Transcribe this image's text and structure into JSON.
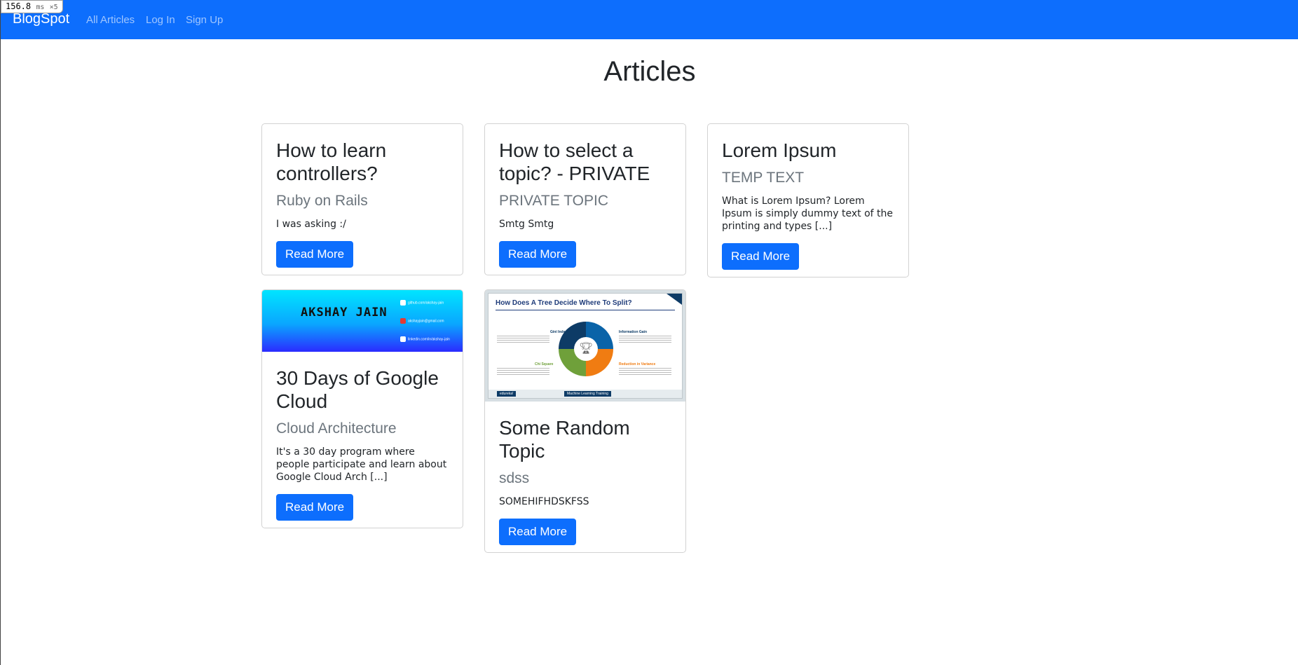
{
  "perf": {
    "value": "156.8",
    "unit": "ms",
    "multiplier": "×5"
  },
  "navbar": {
    "brand": "BlogSpot",
    "links": [
      "All Articles",
      "Log In",
      "Sign Up"
    ]
  },
  "page_title": "Articles",
  "articles": [
    {
      "title": "How to learn controllers?",
      "category": "Ruby on Rails",
      "excerpt": "I was asking :/",
      "button": "Read More"
    },
    {
      "title": "How to select a topic? - PRIVATE",
      "category": "PRIVATE TOPIC",
      "excerpt": "Smtg Smtg",
      "button": "Read More"
    },
    {
      "title": "Lorem Ipsum",
      "category": "TEMP TEXT",
      "excerpt": "What is Lorem Ipsum? Lorem Ipsum is simply dummy text of the printing and types [...]",
      "button": "Read More"
    },
    {
      "title": "30 Days of Google Cloud",
      "category": "Cloud Architecture",
      "excerpt": "It's a 30 day program where people participate and learn about Google Cloud Arch [...]",
      "button": "Read More",
      "image": {
        "name": "AKSHAY JAIN",
        "rows": [
          "github.com/akshay-jain",
          "akshayjain@gmail.com",
          "linkedin.com/in/akshay-jain"
        ]
      }
    },
    {
      "title": "Some Random Topic",
      "category": "sdss",
      "excerpt": "SOMEHIFHDSKFSS",
      "button": "Read More",
      "image": {
        "title": "How Does A Tree Decide Where To Split?",
        "labels": [
          "Gini Index",
          "Information Gain",
          "Chi Square",
          "Reduction in Variance"
        ],
        "footer_left": "edureka!",
        "footer_mid": "Machine Learning Training"
      }
    }
  ],
  "colors": {
    "primary": "#0d6efd",
    "muted": "#6c757d"
  }
}
